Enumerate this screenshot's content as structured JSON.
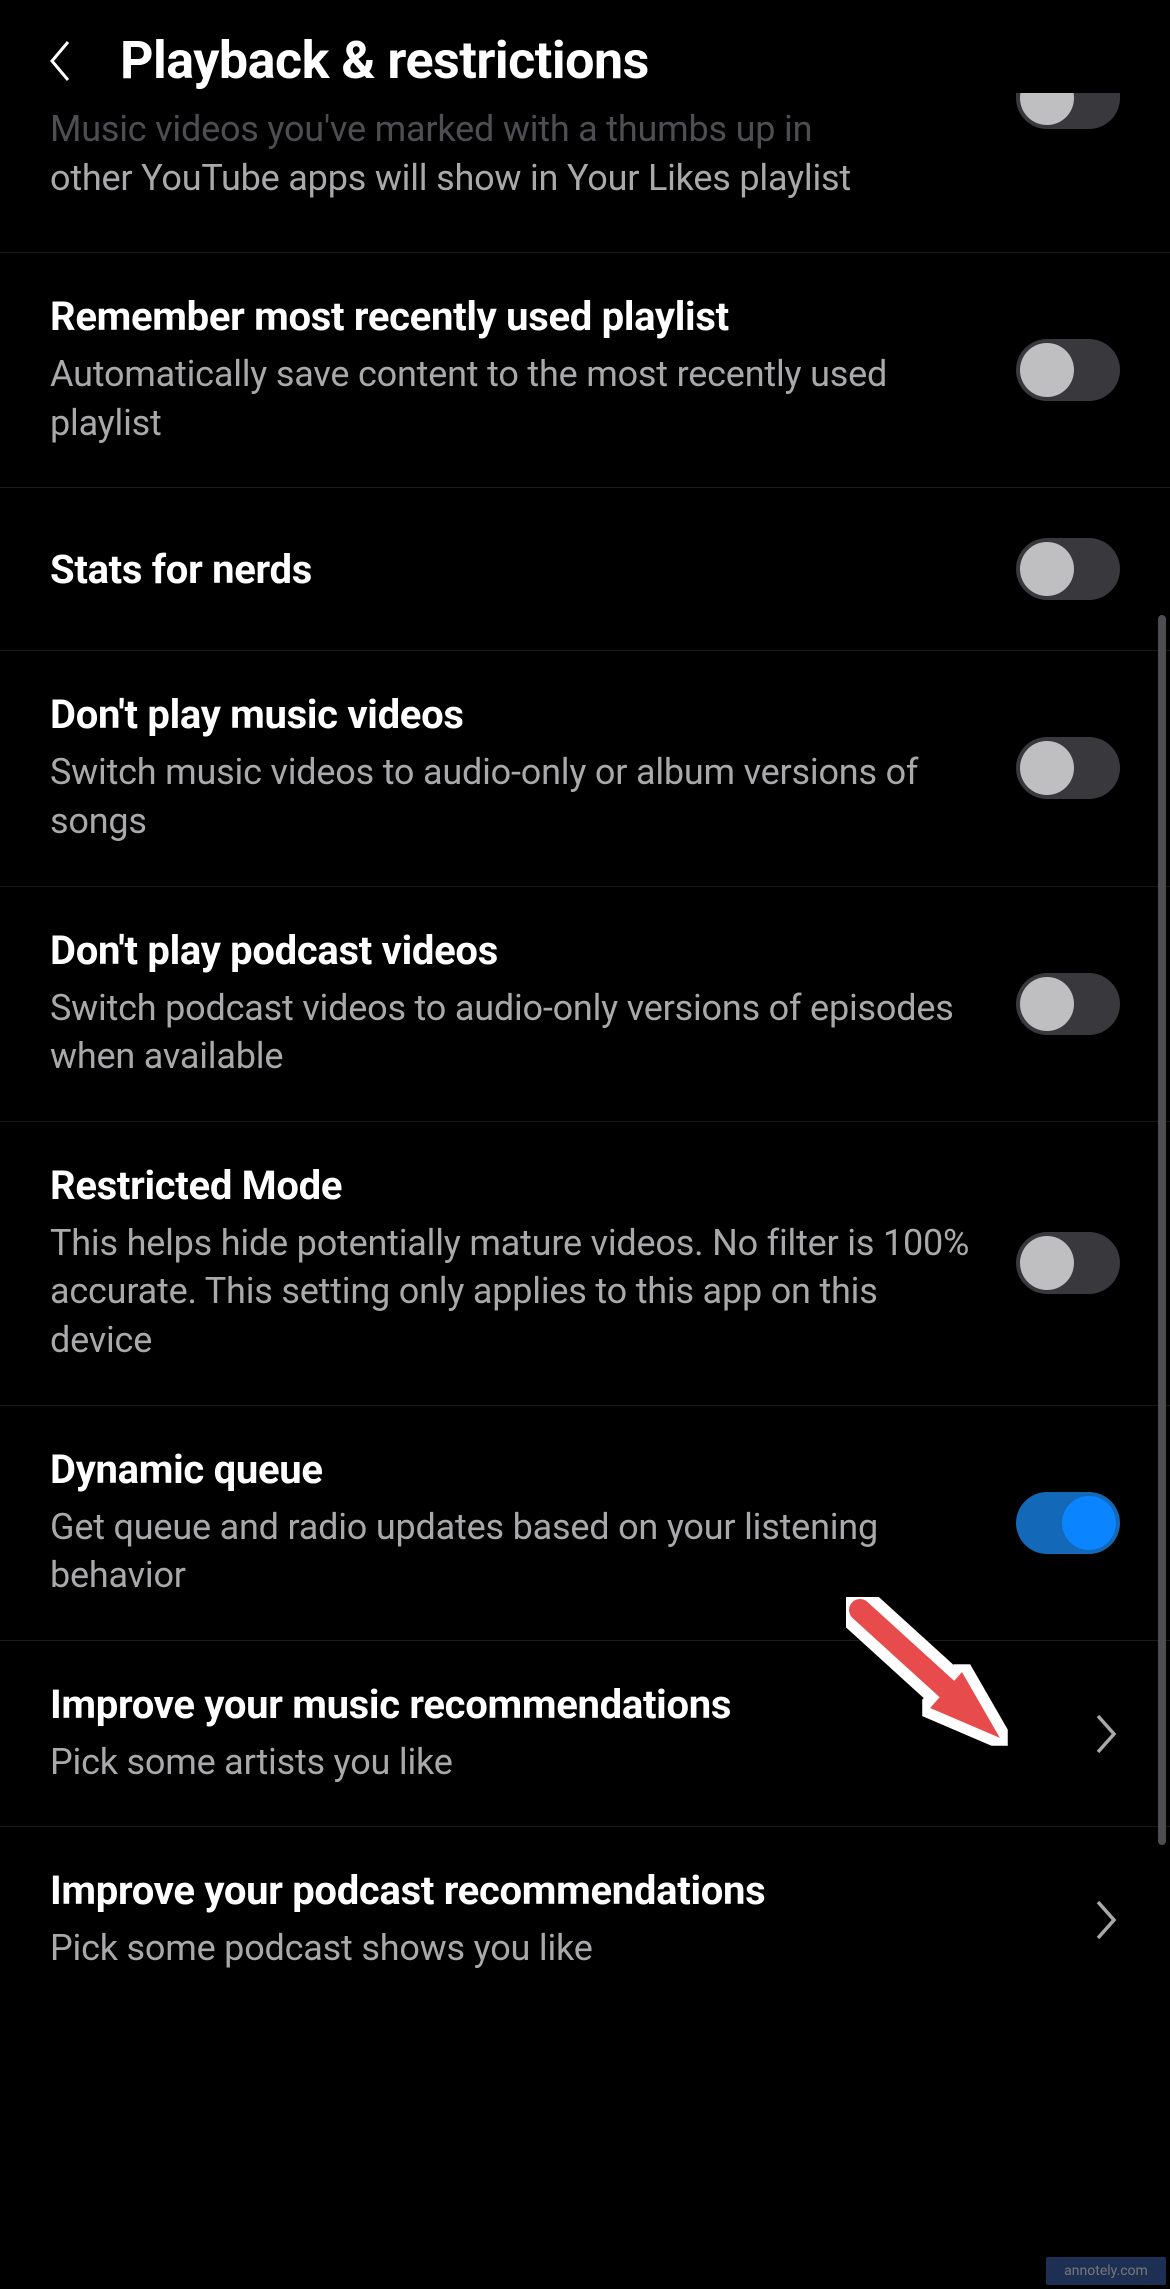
{
  "header": {
    "title": "Playback & restrictions"
  },
  "rows": [
    {
      "id": "liked-videos",
      "title_cut": "Music videos you've marked with a thumbs up in",
      "subtitle": "other YouTube apps will show in Your Likes playlist",
      "control": "toggle",
      "state": "off",
      "cut_top": true
    },
    {
      "id": "remember-playlist",
      "title": "Remember most recently used playlist",
      "subtitle": "Automatically save content to the most recently used playlist",
      "control": "toggle",
      "state": "off"
    },
    {
      "id": "stats-for-nerds",
      "title": "Stats for nerds",
      "subtitle": "",
      "control": "toggle",
      "state": "off"
    },
    {
      "id": "dont-play-music-videos",
      "title": "Don't play music videos",
      "subtitle": "Switch music videos to audio-only or album versions of songs",
      "control": "toggle",
      "state": "off"
    },
    {
      "id": "dont-play-podcast-videos",
      "title": "Don't play podcast videos",
      "subtitle": "Switch podcast videos to audio-only versions of episodes when available",
      "control": "toggle",
      "state": "off"
    },
    {
      "id": "restricted-mode",
      "title": "Restricted Mode",
      "subtitle": "This helps hide potentially mature videos. No filter is 100% accurate. This setting only applies to this app on this device",
      "control": "toggle",
      "state": "off"
    },
    {
      "id": "dynamic-queue",
      "title": "Dynamic queue",
      "subtitle": "Get queue and radio updates based on your listening behavior",
      "control": "toggle",
      "state": "on",
      "annotated": true
    },
    {
      "id": "improve-music-recs",
      "title": "Improve your music recommendations",
      "subtitle": "Pick some artists you like",
      "control": "chevron"
    },
    {
      "id": "improve-podcast-recs",
      "title": "Improve your podcast recommendations",
      "subtitle": "Pick some podcast shows you like",
      "control": "chevron"
    }
  ],
  "watermark": "annotely.com"
}
